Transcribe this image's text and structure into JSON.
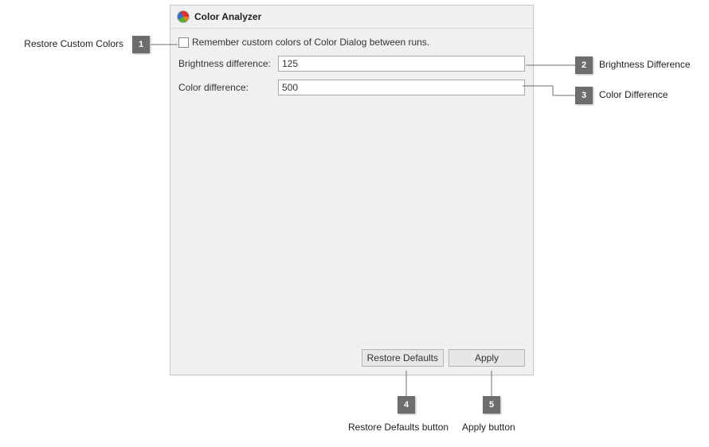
{
  "panel": {
    "title": "Color Analyzer",
    "remember_label": "Remember custom colors of Color Dialog between runs.",
    "brightness_label": "Brightness difference:",
    "brightness_value": "125",
    "color_label": "Color difference:",
    "color_value": "500",
    "restore_btn": "Restore Defaults",
    "apply_btn": "Apply"
  },
  "callouts": {
    "c1_num": "1",
    "c1_text": "Restore Custom Colors",
    "c2_num": "2",
    "c2_text": "Brightness Difference",
    "c3_num": "3",
    "c3_text": "Color Difference",
    "c4_num": "4",
    "c4_text": "Restore Defaults button",
    "c5_num": "5",
    "c5_text": "Apply button"
  }
}
